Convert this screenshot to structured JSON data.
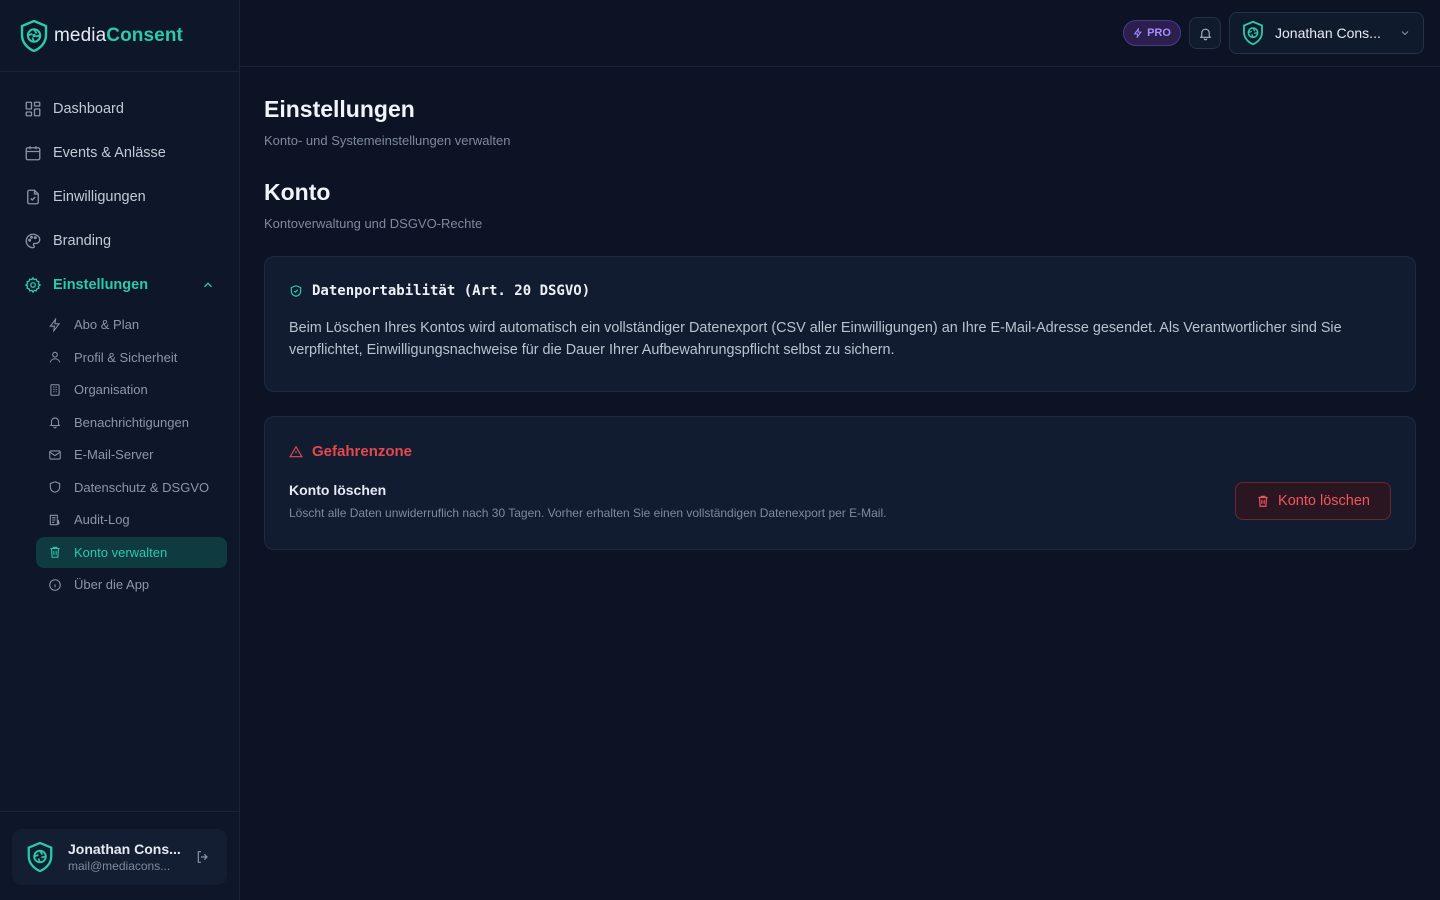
{
  "brand": {
    "name_part1": "media",
    "name_part2": "Consent"
  },
  "sidebar": {
    "items": [
      {
        "label": "Dashboard",
        "icon": "dashboard-grid-icon"
      },
      {
        "label": "Events & Anlässe",
        "icon": "calendar-icon"
      },
      {
        "label": "Einwilligungen",
        "icon": "file-check-icon"
      },
      {
        "label": "Branding",
        "icon": "palette-icon"
      },
      {
        "label": "Einstellungen",
        "icon": "gear-icon",
        "active": true,
        "expanded": true
      }
    ],
    "subitems": [
      {
        "label": "Abo & Plan",
        "icon": "lightning-icon"
      },
      {
        "label": "Profil & Sicherheit",
        "icon": "user-icon"
      },
      {
        "label": "Organisation",
        "icon": "building-icon"
      },
      {
        "label": "Benachrichtigungen",
        "icon": "bell-icon"
      },
      {
        "label": "E-Mail-Server",
        "icon": "mail-icon"
      },
      {
        "label": "Datenschutz & DSGVO",
        "icon": "shield-icon"
      },
      {
        "label": "Audit-Log",
        "icon": "log-icon"
      },
      {
        "label": "Konto verwalten",
        "icon": "trash-icon",
        "active": true
      },
      {
        "label": "Über die App",
        "icon": "info-icon"
      }
    ]
  },
  "user": {
    "name": "Jonathan Cons...",
    "email": "mail@mediacons..."
  },
  "header": {
    "badge": "PRO",
    "account_name": "Jonathan Cons..."
  },
  "page": {
    "title": "Einstellungen",
    "subtitle": "Konto- und Systemeinstellungen verwalten"
  },
  "section": {
    "title": "Konto",
    "subtitle": "Kontoverwaltung und DSGVO-Rechte"
  },
  "portability": {
    "title": "Datenportabilität (Art. 20 DSGVO)",
    "text": "Beim Löschen Ihres Kontos wird automatisch ein vollständiger Datenexport (CSV aller Einwilligungen) an Ihre E-Mail-Adresse gesendet. Als Verantwortlicher sind Sie verpflichtet, Einwilligungsnachweise für die Dauer Ihrer Aufbewahrungspflicht selbst zu sichern."
  },
  "danger": {
    "title": "Gefahrenzone",
    "label": "Konto löschen",
    "description": "Löscht alle Daten unwiderruflich nach 30 Tagen. Vorher erhalten Sie einen vollständigen Datenexport per E-Mail.",
    "button": "Konto löschen"
  },
  "colors": {
    "accent": "#2cc9ad",
    "danger": "#e5484d",
    "pro": "#a98bff",
    "background": "#0b1324"
  }
}
